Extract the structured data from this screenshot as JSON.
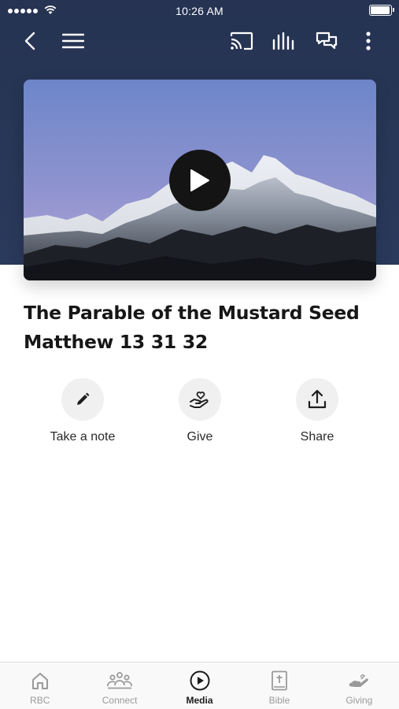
{
  "status_bar": {
    "time": "10:26 AM",
    "battery_level": 0.9
  },
  "toolbar": {
    "icons": [
      "back-chevron-icon",
      "menu-icon",
      "cast-icon",
      "audio-bars-icon",
      "chat-icon",
      "more-vertical-icon"
    ]
  },
  "video": {
    "thumbnail": "snowy-mountain",
    "play_icon": "play-icon"
  },
  "media": {
    "title": "The Parable of the Mustard Seed Matthew 13 31 32"
  },
  "actions": [
    {
      "label": "Take a note",
      "icon": "pencil-icon"
    },
    {
      "label": "Give",
      "icon": "heart-hand-icon"
    },
    {
      "label": "Share",
      "icon": "share-icon"
    }
  ],
  "bottom_nav": {
    "active": "Media",
    "items": [
      {
        "label": "RBC",
        "icon": "home-icon"
      },
      {
        "label": "Connect",
        "icon": "people-icon"
      },
      {
        "label": "Media",
        "icon": "play-circle-icon"
      },
      {
        "label": "Bible",
        "icon": "bible-icon"
      },
      {
        "label": "Giving",
        "icon": "giving-hand-icon"
      }
    ]
  },
  "colors": {
    "header_background": "#263352",
    "action_circle": "#f0f0f1",
    "nav_active": "#1c1c1e",
    "nav_inactive": "#9a9a9a"
  }
}
